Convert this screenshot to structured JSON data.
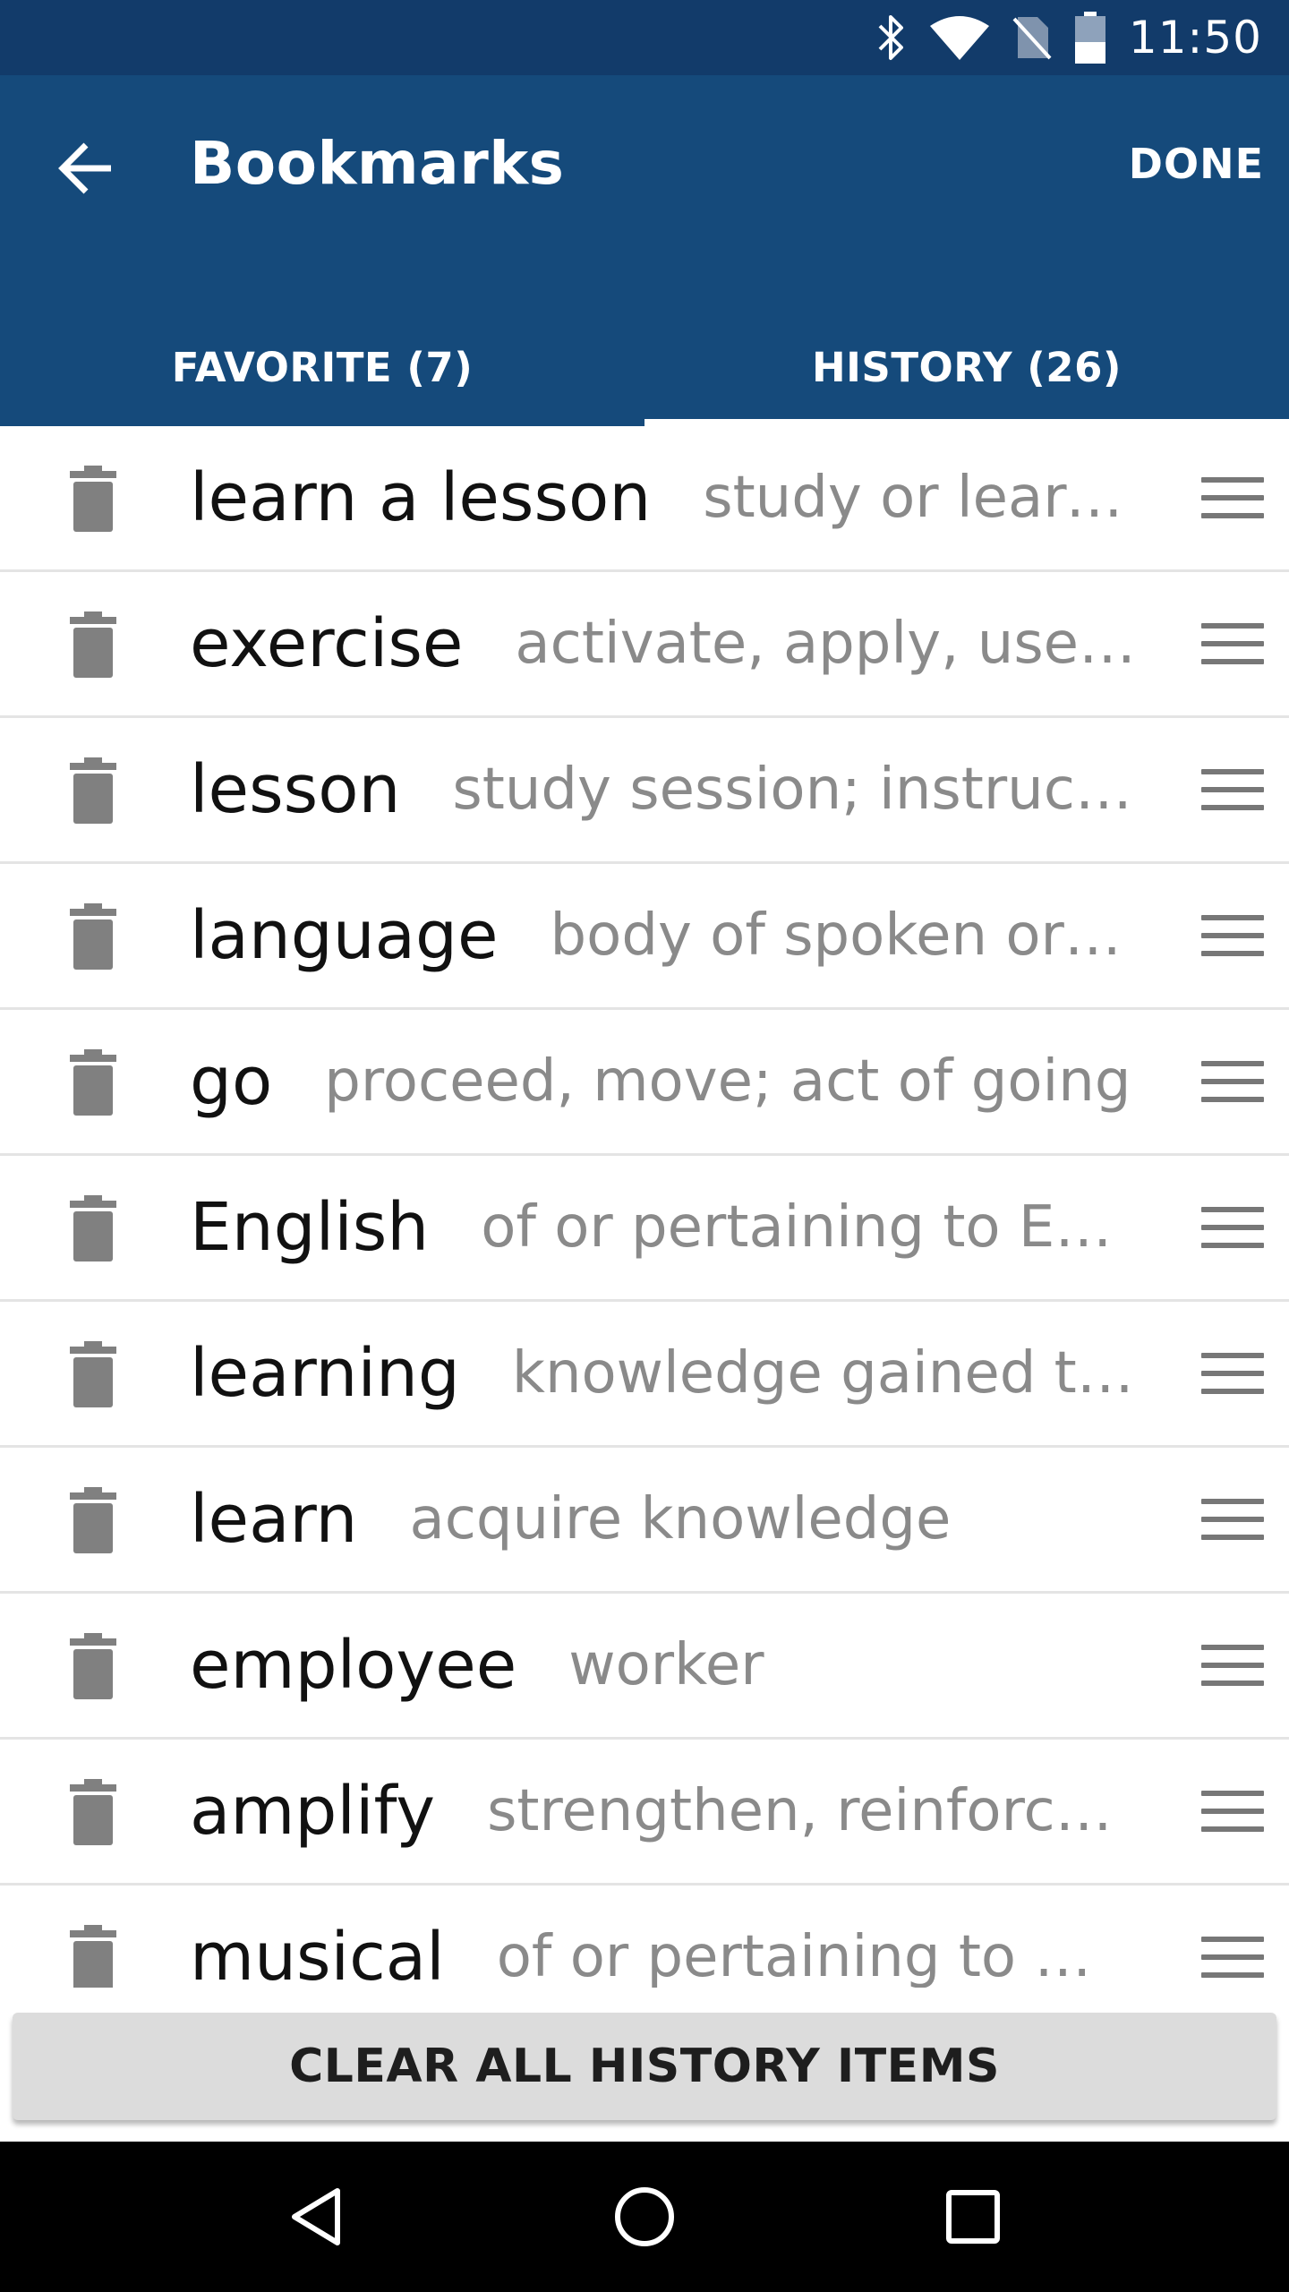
{
  "status_bar": {
    "time": "11:50",
    "icons": [
      "bluetooth-icon",
      "wifi-icon",
      "no-sim-icon",
      "battery-icon"
    ]
  },
  "app_bar": {
    "back_icon": "arrow-back-icon",
    "title": "Bookmarks",
    "done_label": "DONE"
  },
  "tabs": [
    {
      "label": "FAVORITE (7)",
      "active": false
    },
    {
      "label": "HISTORY (26)",
      "active": true
    }
  ],
  "history": [
    {
      "term": "learn a lesson",
      "definition": "study or learn by heart"
    },
    {
      "term": "exercise",
      "definition": "activate, apply, use; drill"
    },
    {
      "term": "lesson",
      "definition": "study session; instruct, teach"
    },
    {
      "term": "language",
      "definition": "body of spoken or written words"
    },
    {
      "term": "go",
      "definition": "proceed, move; act of going"
    },
    {
      "term": "English",
      "definition": "of or pertaining to England"
    },
    {
      "term": "learning",
      "definition": "knowledge gained through study"
    },
    {
      "term": "learn",
      "definition": "acquire knowledge"
    },
    {
      "term": "employee",
      "definition": "worker"
    },
    {
      "term": "amplify",
      "definition": "strengthen, reinforce, enlarge"
    },
    {
      "term": "musical",
      "definition": "of or pertaining to music"
    }
  ],
  "row_icons": {
    "delete": "trash-icon",
    "reorder": "drag-handle-icon"
  },
  "clear_button": {
    "label": "CLEAR ALL HISTORY ITEMS"
  },
  "nav_bar": {
    "icons": [
      "back-triangle-icon",
      "home-circle-icon",
      "recents-square-icon"
    ]
  },
  "colors": {
    "status_bar": "#123b6a",
    "app_bar": "#154a7b",
    "term_text": "#111111",
    "definition_text": "#8a8a8a",
    "icon_gray": "#808080"
  }
}
